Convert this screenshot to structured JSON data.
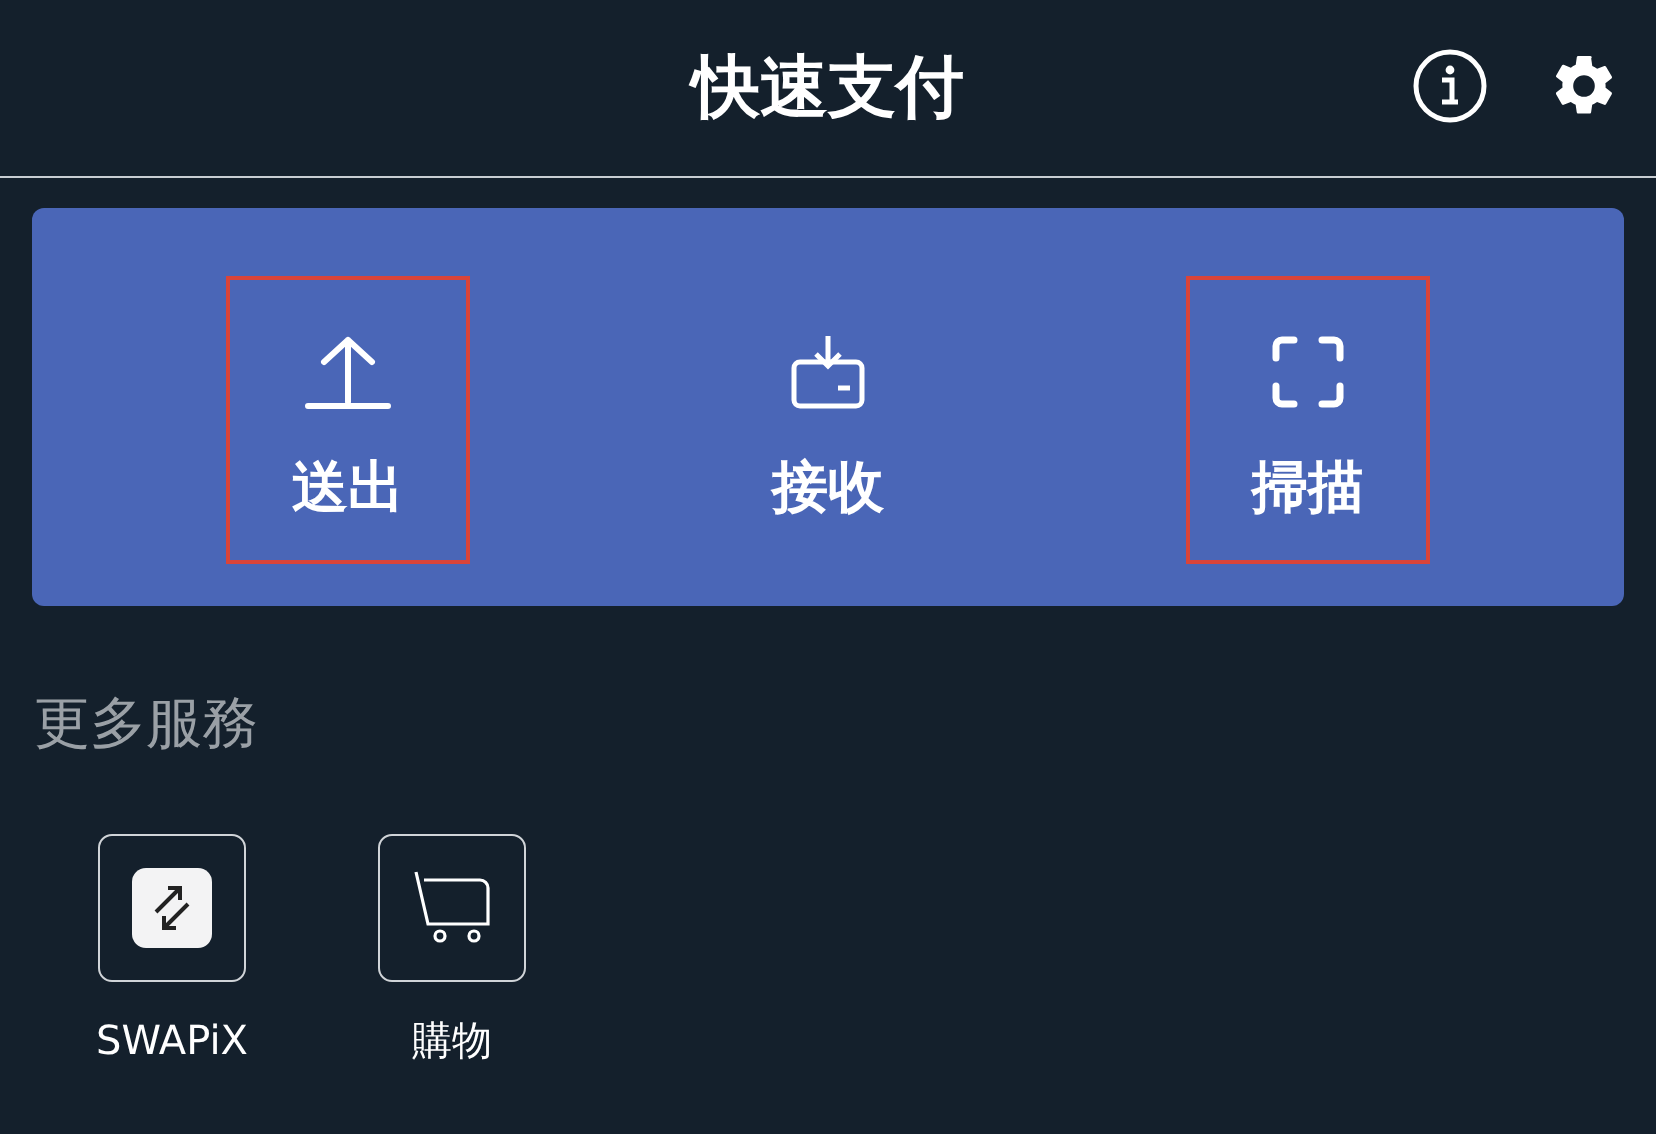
{
  "header": {
    "title": "快速支付"
  },
  "actions": [
    {
      "label": "送出",
      "kind": "send",
      "highlighted": true
    },
    {
      "label": "接收",
      "kind": "receive",
      "highlighted": false
    },
    {
      "label": "掃描",
      "kind": "scan",
      "highlighted": true
    }
  ],
  "more_services": {
    "heading": "更多服務",
    "items": [
      {
        "label": "SWAPiX",
        "kind": "swap"
      },
      {
        "label": "購物",
        "kind": "cart"
      }
    ]
  }
}
